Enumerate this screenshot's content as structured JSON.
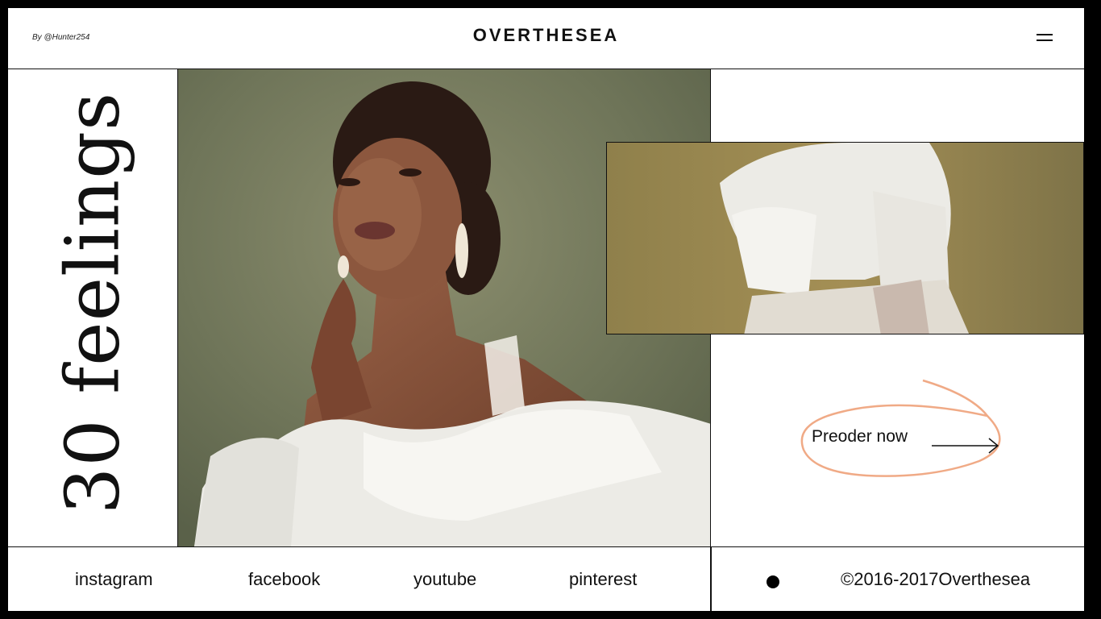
{
  "header": {
    "byline": "By @Hunter254",
    "brand": "OVERTHESEA",
    "menu_icon": "hamburger-icon"
  },
  "hero": {
    "vertical_title": "30 feelings",
    "cta_label": "Preoder now",
    "cta_icon": "arrow-right-icon",
    "cta_outline_color": "#f0aa86"
  },
  "footer": {
    "social_links": [
      "instagram",
      "facebook",
      "youtube",
      "pinterest"
    ],
    "copyright": "©2016-2017Overthesea"
  }
}
